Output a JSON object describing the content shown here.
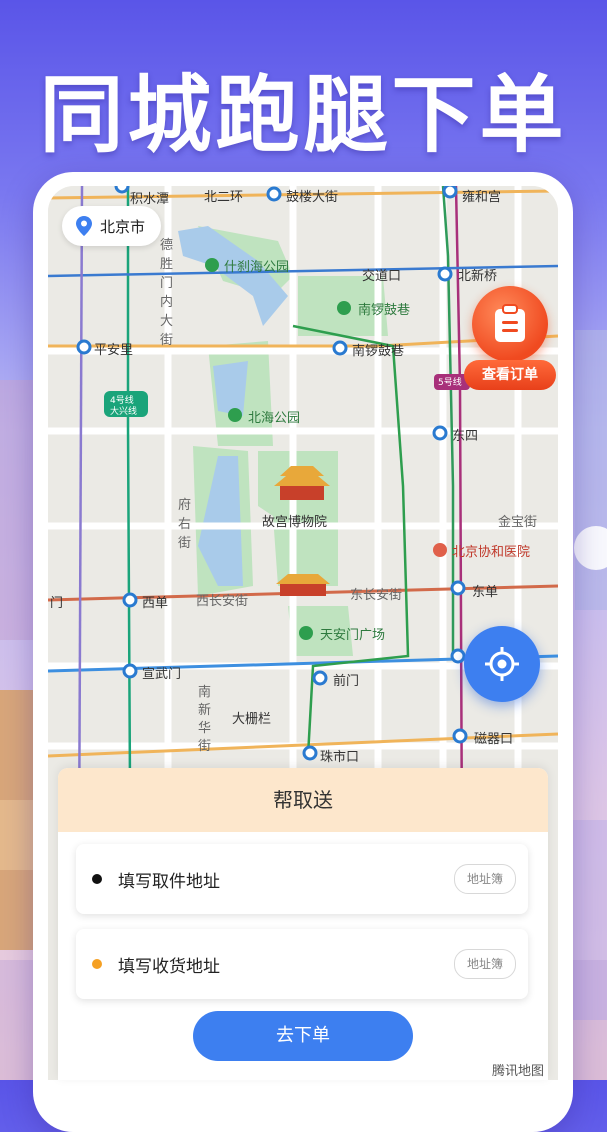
{
  "headline": "同城跑腿下单",
  "city": {
    "name": "北京市",
    "icon": "location-pin-icon"
  },
  "orders_button": {
    "label": "查看订单",
    "icon": "clipboard-icon"
  },
  "locate_button": {
    "icon": "crosshair-icon"
  },
  "map": {
    "labels": {
      "jishuitan": "积水潭",
      "beierhuan": "北二环",
      "gulou": "鼓楼大街",
      "yonghegong": "雍和宫",
      "deshengmen": "德胜门内大街",
      "shichahai": "什刹海公园",
      "jiaodaokou": "交道口",
      "beixinqiao": "北新桥",
      "nanluoguxiang_poi": "南锣鼓巷",
      "nanluoguxiang_st": "南锣鼓巷",
      "pinganli": "平安里",
      "line4": "4号线",
      "daxing": "大兴线",
      "line5": "5号线",
      "beihai": "北海公园",
      "dongsi": "东四",
      "fuyoujie": "府右街",
      "gugong": "故宫博物院",
      "jinbaojie": "金宝街",
      "xiehe": "北京协和医院",
      "men": "门",
      "xidan": "西单",
      "xichanganjie": "西长安街",
      "dongchanganjie": "东长安街",
      "dongdan": "东单",
      "tiananmen": "天安门广场",
      "xuanwumen": "宣武门",
      "qianmen": "前门",
      "nanxinhua": "南新华街",
      "dashilan": "大栅栏",
      "ciqikou": "磁器口",
      "zhushikou": "珠市口"
    }
  },
  "panel": {
    "title": "帮取送",
    "pickup": {
      "placeholder": "填写取件地址",
      "book": "地址簿",
      "dot_color": "#111111"
    },
    "delivery": {
      "placeholder": "填写收货地址",
      "book": "地址簿",
      "dot_color": "#f5a023"
    },
    "submit": "去下单"
  },
  "watermark": "腾讯地图",
  "colors": {
    "accent": "#3d7ff0",
    "orange": "#f04a20",
    "panel_head": "#fde7cc"
  }
}
